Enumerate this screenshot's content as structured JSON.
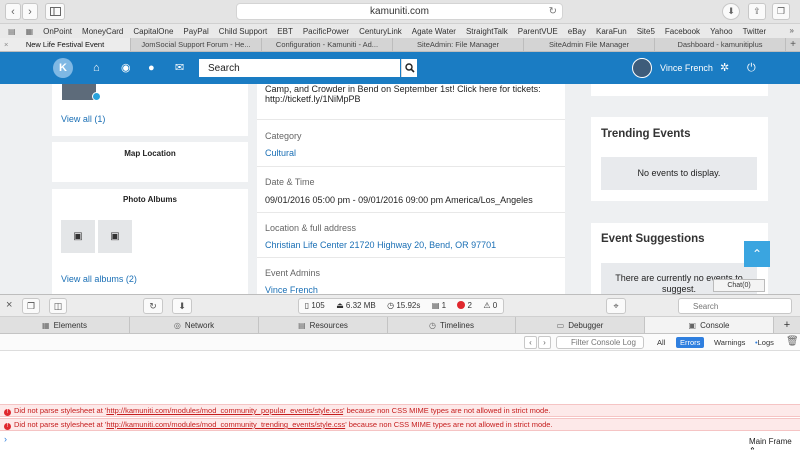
{
  "browser": {
    "url": "kamuniti.com",
    "bookmarks": [
      "OnPoint",
      "MoneyCard",
      "CapitalOne",
      "PayPal",
      "Child Support",
      "EBT",
      "PacificPower",
      "CenturyLink",
      "Agate Water",
      "StraightTalk",
      "ParentVUE",
      "eBay",
      "KaraFun",
      "Site5",
      "Facebook",
      "Yahoo",
      "Twitter"
    ],
    "bookmarks_more": "»",
    "tabs": [
      {
        "label": "New Life Festival Event",
        "active": true
      },
      {
        "label": "JomSocial Support Forum - He...",
        "active": false
      },
      {
        "label": "Configuration - Kamuniti - Ad...",
        "active": false
      },
      {
        "label": "SiteAdmin: File Manager",
        "active": false
      },
      {
        "label": "SiteAdmin File Manager",
        "active": false
      },
      {
        "label": "Dashboard - kamunitiplus",
        "active": false
      }
    ],
    "tab_close": "×",
    "tab_add": "+"
  },
  "site": {
    "logo_letter": "K",
    "search_placeholder": "Search",
    "user_name": "Vince French"
  },
  "left": {
    "view_all": "View all (1)",
    "map_title": "Map Location",
    "albums_title": "Photo Albums",
    "view_all_albums": "View all albums (2)"
  },
  "event": {
    "desc_line1": "Camp, and Crowder in Bend on September 1st! Click here for tickets:",
    "desc_line2": "http://ticketf.ly/1NiMpPB",
    "category_label": "Category",
    "category_value": "Cultural",
    "datetime_label": "Date & Time",
    "datetime_value": "09/01/2016 05:00 pm - 09/01/2016 09:00 pm America/Los_Angeles",
    "location_label": "Location & full address",
    "location_value": "Christian Life Center 21720 Highway 20, Bend, OR 97701",
    "admins_label": "Event Admins",
    "admins_value": "Vince French"
  },
  "right": {
    "trending_title": "Trending Events",
    "trending_empty": "No events to display.",
    "suggest_title": "Event Suggestions",
    "suggest_empty_line1": "There are currently no events to",
    "suggest_empty_line2": "suggest.",
    "chat_label": "Chat(0)"
  },
  "inspector": {
    "resources_count": "105",
    "size": "6.32 MB",
    "time": "15.92s",
    "logs": "1",
    "errors": "2",
    "warnings": "0",
    "search_placeholder": "Search",
    "tabs": [
      {
        "label": "Elements",
        "icon": "▦"
      },
      {
        "label": "Network",
        "icon": "◎"
      },
      {
        "label": "Resources",
        "icon": "▤"
      },
      {
        "label": "Timelines",
        "icon": "◷"
      },
      {
        "label": "Debugger",
        "icon": "▭"
      },
      {
        "label": "Console",
        "icon": "▣"
      }
    ],
    "filter_placeholder": "Filter Console Log",
    "levels": [
      "All",
      "Errors",
      "Warnings",
      "Logs"
    ],
    "messages": [
      {
        "pre": "Did not parse stylesheet at '",
        "url": "http://kamuniti.com/modules/mod_community_popular_events/style.css",
        "post": "' because non CSS MIME types are not allowed in strict mode."
      },
      {
        "pre": "Did not parse stylesheet at '",
        "url": "http://kamuniti.com/modules/mod_community_trending_events/style.css",
        "post": "' because non CSS MIME types are not allowed in strict mode."
      }
    ],
    "frame": "Main Frame"
  }
}
